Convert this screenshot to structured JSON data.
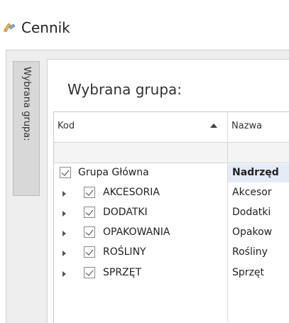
{
  "window": {
    "title": "Cennik",
    "icon": "price-list-icon"
  },
  "side_tab": {
    "label": "Wybrana grupa:"
  },
  "panel": {
    "heading": "Wybrana grupa:"
  },
  "grid": {
    "columns": [
      {
        "label": "Kod",
        "sort": "ascending"
      },
      {
        "label": "Nazwa"
      }
    ],
    "rows": [
      {
        "kod": "Grupa Główna",
        "nazwa": "Nadrzęd",
        "checked": true,
        "expandable": false,
        "selected": true
      },
      {
        "kod": "AKCESORIA",
        "nazwa": "Akcesor",
        "checked": true,
        "expandable": true,
        "selected": false
      },
      {
        "kod": "DODATKI",
        "nazwa": "Dodatki",
        "checked": true,
        "expandable": true,
        "selected": false
      },
      {
        "kod": "OPAKOWANIA",
        "nazwa": "Opakow",
        "checked": true,
        "expandable": true,
        "selected": false
      },
      {
        "kod": "ROŚLINY",
        "nazwa": "Rośliny",
        "checked": true,
        "expandable": true,
        "selected": false
      },
      {
        "kod": "SPRZĘT",
        "nazwa": "Sprzęt",
        "checked": true,
        "expandable": true,
        "selected": false
      }
    ]
  }
}
